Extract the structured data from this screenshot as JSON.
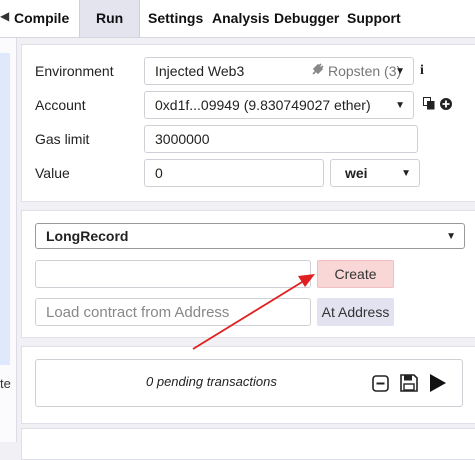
{
  "tabs": {
    "overflow_icon": "chevron-left-icon",
    "items": [
      {
        "label": "Compile"
      },
      {
        "label": "Run",
        "active": true
      },
      {
        "label": "Settings"
      },
      {
        "label": "Analysis"
      },
      {
        "label": "Debugger"
      },
      {
        "label": "Support"
      }
    ]
  },
  "left_panel": {
    "text": "te"
  },
  "environment": {
    "label": "Environment",
    "value": "Injected Web3",
    "network": "Ropsten (3)",
    "network_icon": "plug-icon",
    "info_icon": "info-icon"
  },
  "account": {
    "label": "Account",
    "value": "0xd1f...09949 (9.830749027 ether)",
    "copy_icon": "copy-icon",
    "add_icon": "plus-circle-icon"
  },
  "gas": {
    "label": "Gas limit",
    "value": "3000000"
  },
  "value_field": {
    "label": "Value",
    "value": "0",
    "unit": "wei"
  },
  "contract": {
    "selected": "LongRecord",
    "create_label": "Create",
    "create_args_value": "",
    "load_placeholder": "Load contract from Address",
    "at_address_label": "At Address"
  },
  "transactions": {
    "pending_text": "0 pending transactions",
    "collapse_icon": "minus-square-icon",
    "save_icon": "floppy-disk-icon",
    "play_icon": "play-icon"
  },
  "annotation": {
    "arrow_color": "#e02020"
  },
  "colors": {
    "create_button": "#f9d7d7",
    "at_address_button": "#e2e2f0",
    "background": "#f0f0f5"
  }
}
